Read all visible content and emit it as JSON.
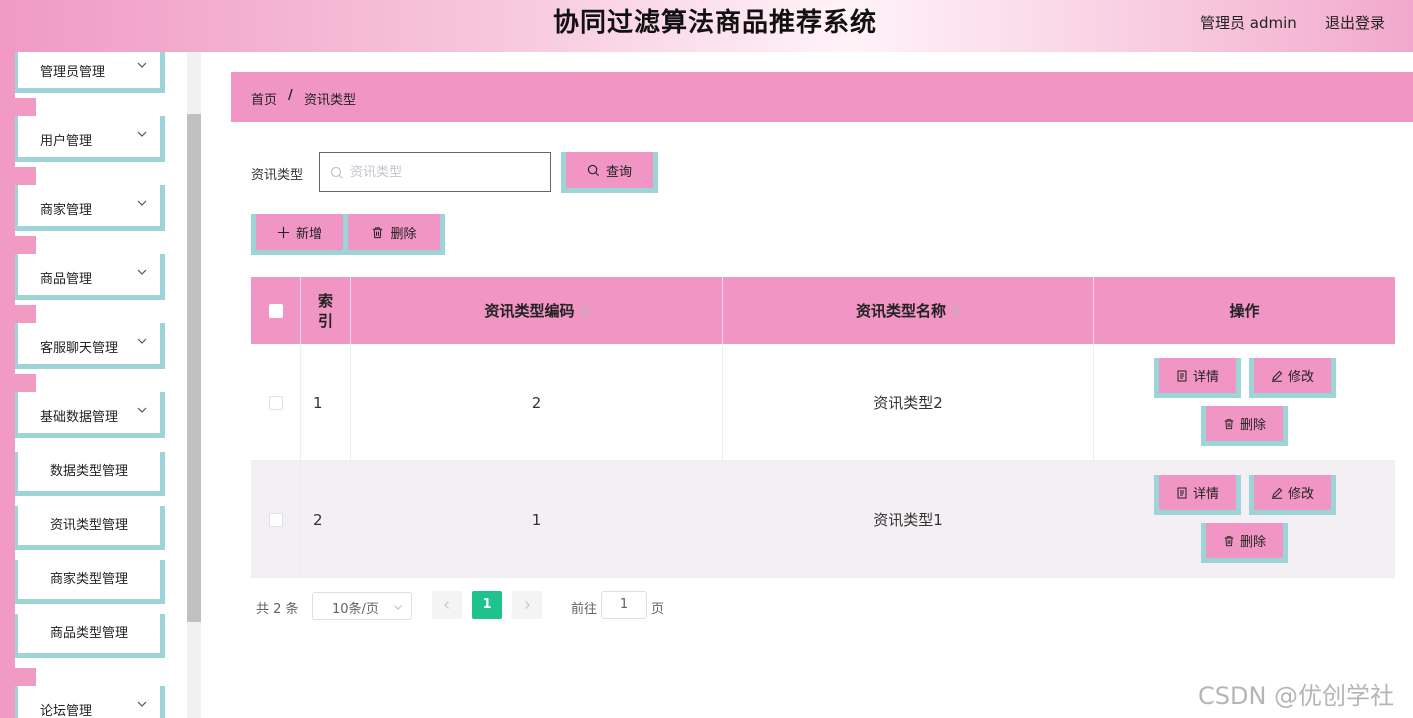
{
  "header": {
    "title": "协同过滤算法商品推荐系统",
    "user": "管理员 admin",
    "logout": "退出登录"
  },
  "sidebar": {
    "menus": [
      {
        "label": "管理员管理"
      },
      {
        "label": "用户管理"
      },
      {
        "label": "商家管理"
      },
      {
        "label": "商品管理"
      },
      {
        "label": "客服聊天管理"
      },
      {
        "label": "基础数据管理"
      }
    ],
    "submenus": [
      {
        "label": "数据类型管理"
      },
      {
        "label": "资讯类型管理"
      },
      {
        "label": "商家类型管理"
      },
      {
        "label": "商品类型管理"
      }
    ],
    "last_menu": {
      "label": "论坛管理"
    }
  },
  "breadcrumb": {
    "home": "首页",
    "separator": "/",
    "current": "资讯类型"
  },
  "search": {
    "label": "资讯类型",
    "placeholder": "资讯类型",
    "value": "",
    "button": "查询"
  },
  "actions": {
    "add": "新增",
    "delete": "删除"
  },
  "table": {
    "columns": {
      "index": "索\n引",
      "code": "资讯类型编码",
      "name": "资讯类型名称",
      "ops": "操作"
    },
    "rows": [
      {
        "index": "1",
        "code": "2",
        "name": "资讯类型2"
      },
      {
        "index": "2",
        "code": "1",
        "name": "资讯类型1"
      }
    ],
    "row_buttons": {
      "detail": "详情",
      "edit": "修改",
      "delete": "删除"
    }
  },
  "pagination": {
    "total": "共 2 条",
    "page_size": "10条/页",
    "current_page": "1",
    "goto_label": "前往",
    "goto_value": "1",
    "goto_unit": "页"
  },
  "watermark": "CSDN @优创学社",
  "colors": {
    "accent_pink": "#f095c4",
    "border_teal": "#9cd4d8",
    "active_page": "#1ec28c"
  }
}
